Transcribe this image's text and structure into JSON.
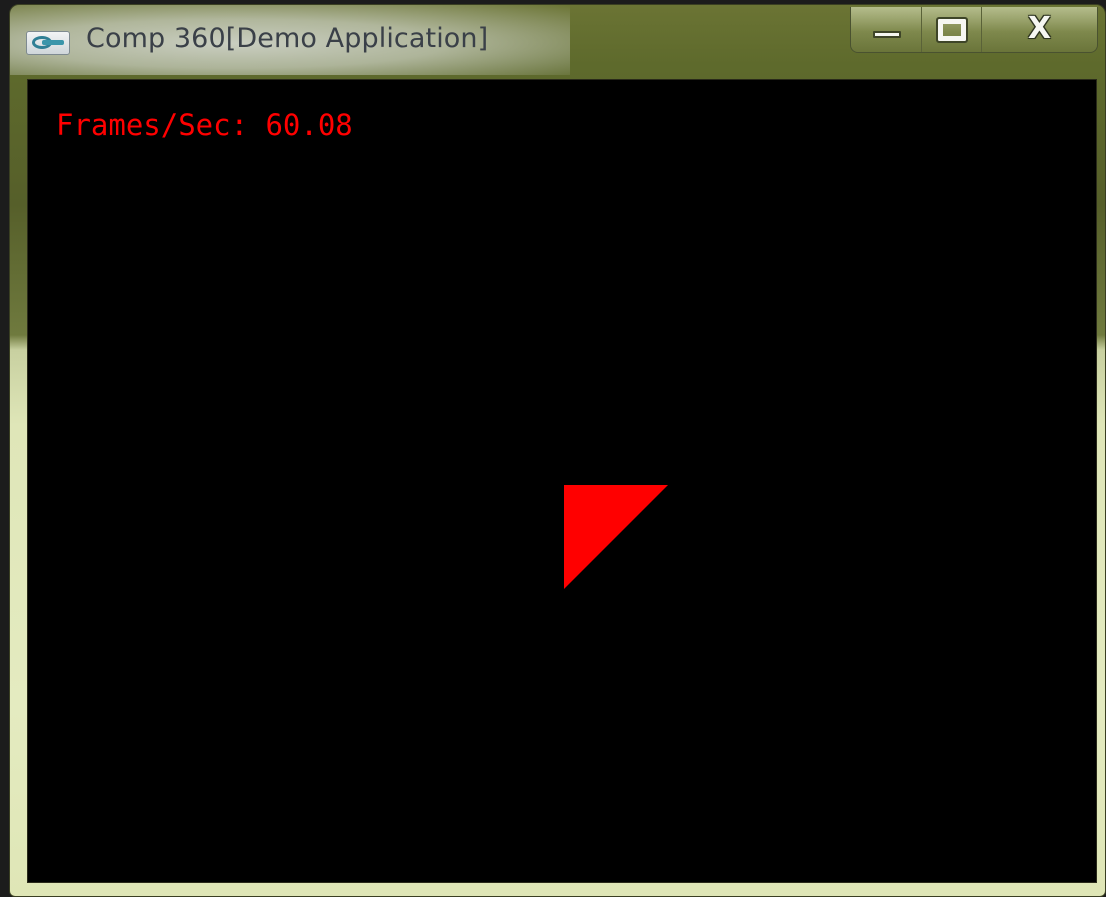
{
  "window": {
    "title": "Comp 360[Demo Application]",
    "app_icon": "application-icon",
    "caption_buttons": {
      "minimize": "minimize-icon",
      "maximize": "maximize-icon",
      "close_label": "X"
    }
  },
  "viewport": {
    "background_color": "#000000",
    "fps_label": "Frames/Sec:",
    "fps_value": "60.08",
    "text_color": "#ff0000",
    "shape": {
      "kind": "triangle",
      "fill": "#ff0000"
    }
  }
}
